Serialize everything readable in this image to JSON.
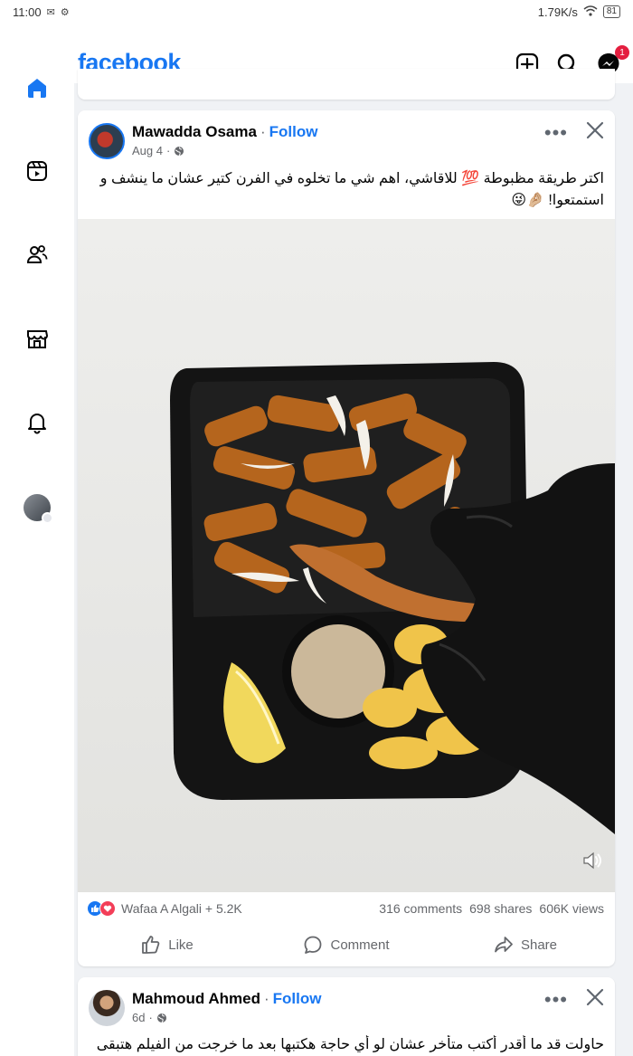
{
  "status_bar": {
    "time": "11:00",
    "speed": "1.79K/s",
    "battery": "81"
  },
  "header": {
    "logo": "facebook",
    "messenger_badge": "1",
    "icons": [
      "add-icon",
      "search-icon",
      "messenger-icon"
    ]
  },
  "rail": {
    "items": [
      "home-icon",
      "video-icon",
      "friends-icon",
      "marketplace-icon",
      "notifications-icon",
      "profile-avatar"
    ]
  },
  "post": {
    "author": "Mawadda Osama",
    "follow_label": "Follow",
    "date": "Aug 4",
    "text": "اكتر طريقة مظبوطة 💯 للاقاشي، اهم شي ما تخلوه في الفرن كتير عشان ما ينشف و استمتعوا! 🤌🏼😜",
    "reactions_text": "Wafaa A Algali + 5.2K",
    "comments": "316 comments",
    "shares": "698 shares",
    "views": "606K views",
    "like_label": "Like",
    "comment_label": "Comment",
    "share_label": "Share"
  },
  "post2": {
    "author": "Mahmoud Ahmed",
    "follow_label": "Follow",
    "date": "6d",
    "text": "حاولت قد ما أقدر أكتب متأخر عشان لو أي حاجة هكتبها بعد ما خرجت من الفيلم هتبقى"
  },
  "colors": {
    "brand": "#1877f2",
    "badge": "#e41e3f"
  }
}
